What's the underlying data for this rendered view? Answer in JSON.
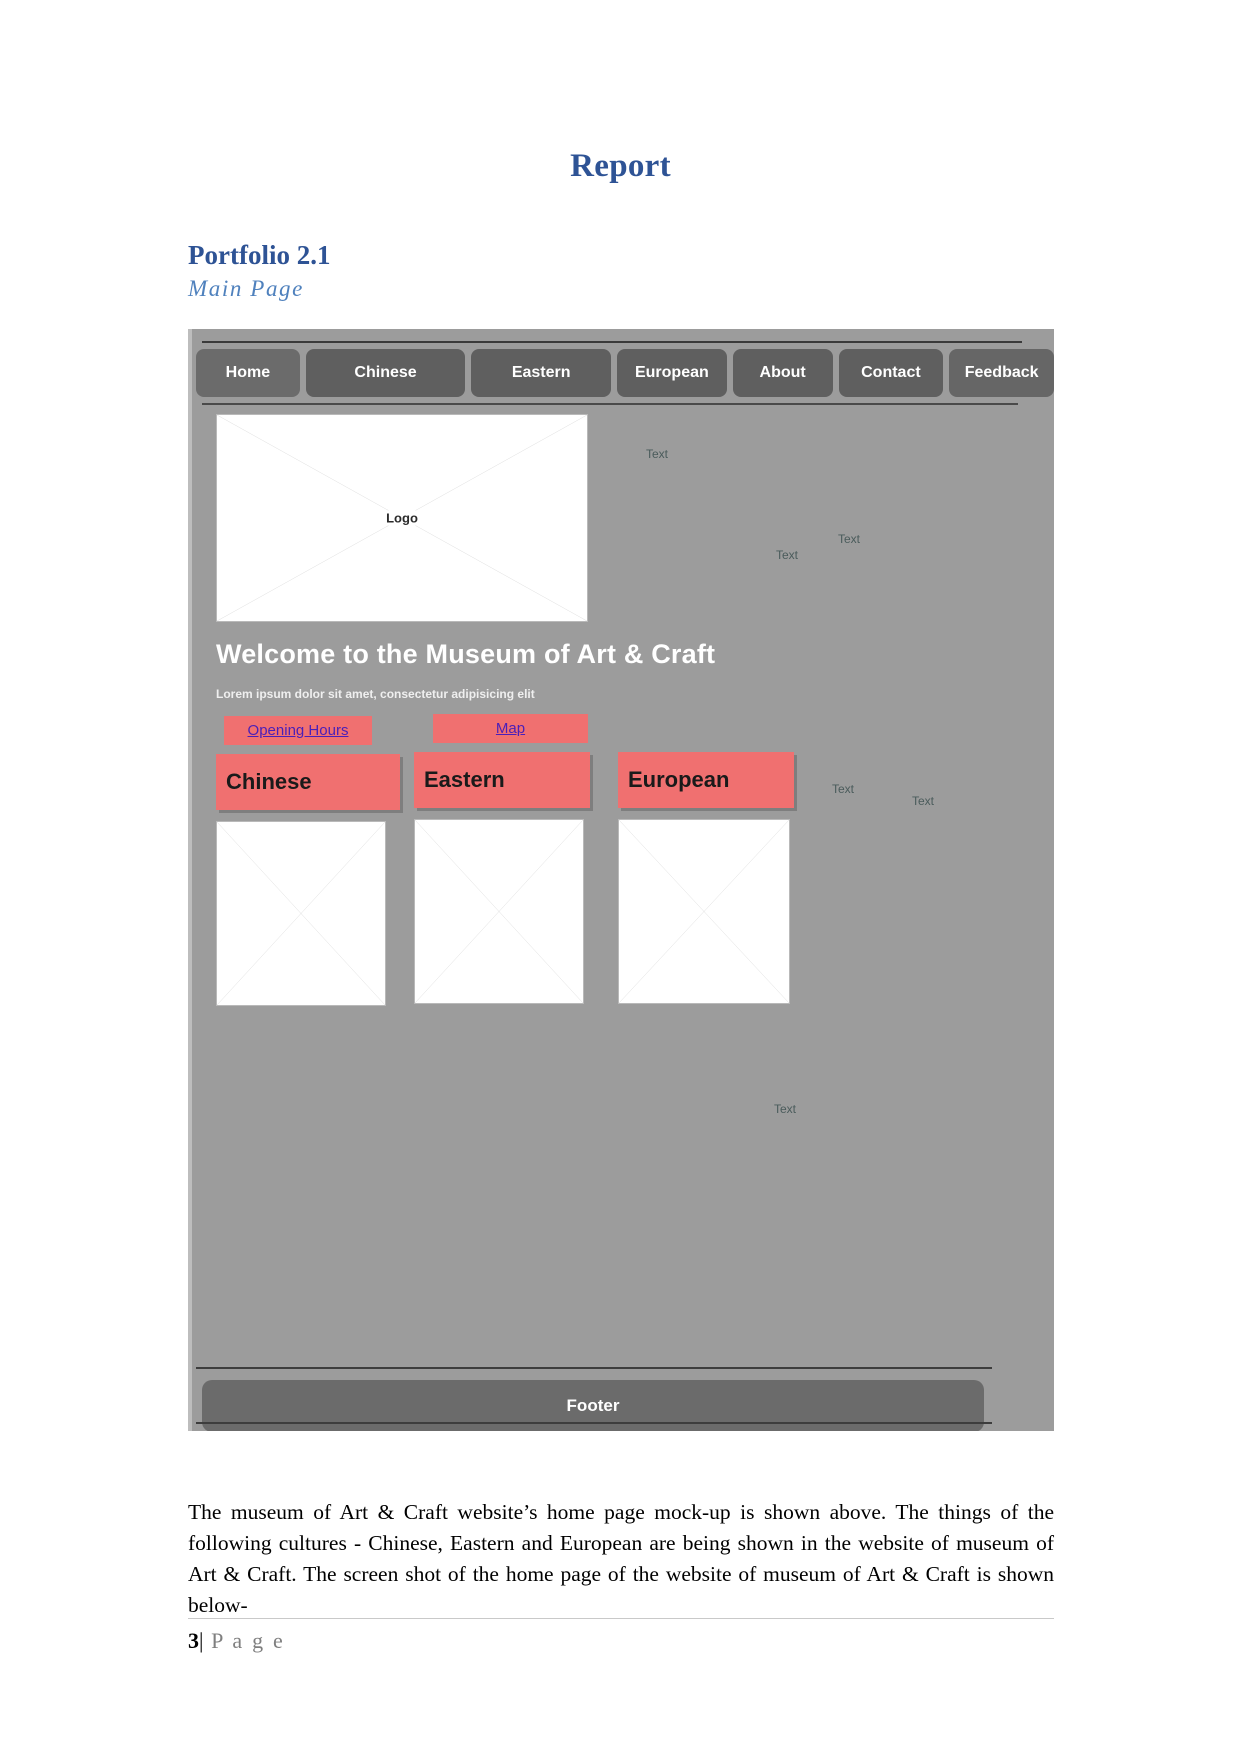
{
  "document": {
    "title": "Report",
    "heading": "Portfolio 2.1",
    "subheading": "Main Page",
    "body_paragraph": "The museum of Art & Craft website’s home page mock-up is shown above. The things of the following cultures - Chinese, Eastern and European are being shown in the website of museum of Art & Craft. The screen shot of the home page of the website of museum of Art & Craft is shown below-",
    "page_footer": {
      "number": "3",
      "separator": "|",
      "label": "P a g e"
    }
  },
  "mockup": {
    "nav": [
      {
        "label": "Home"
      },
      {
        "label": "Chinese"
      },
      {
        "label": "Eastern"
      },
      {
        "label": "European"
      },
      {
        "label": "About"
      },
      {
        "label": "Contact"
      },
      {
        "label": "Feedback"
      }
    ],
    "logo_placeholder": "Logo",
    "welcome_heading": "Welcome to the Museum of Art & Craft",
    "lorem": "Lorem ipsum dolor sit amet, consectetur adipisicing elit",
    "links": {
      "opening_hours": "Opening Hours",
      "map": "Map"
    },
    "categories": [
      {
        "label": "Chinese"
      },
      {
        "label": "Eastern"
      },
      {
        "label": "European"
      }
    ],
    "floating_text_labels": [
      "Text",
      "Text",
      "Text",
      "Text",
      "Text",
      "Text"
    ],
    "footer": "Footer",
    "colors": {
      "canvas": "#9c9c9c",
      "nav_button": "#5f5f5f",
      "accent_pink": "#f07070",
      "link": "#4a1fb8",
      "heading_blue": "#2e5395",
      "subheading_blue": "#4f81bd"
    }
  }
}
